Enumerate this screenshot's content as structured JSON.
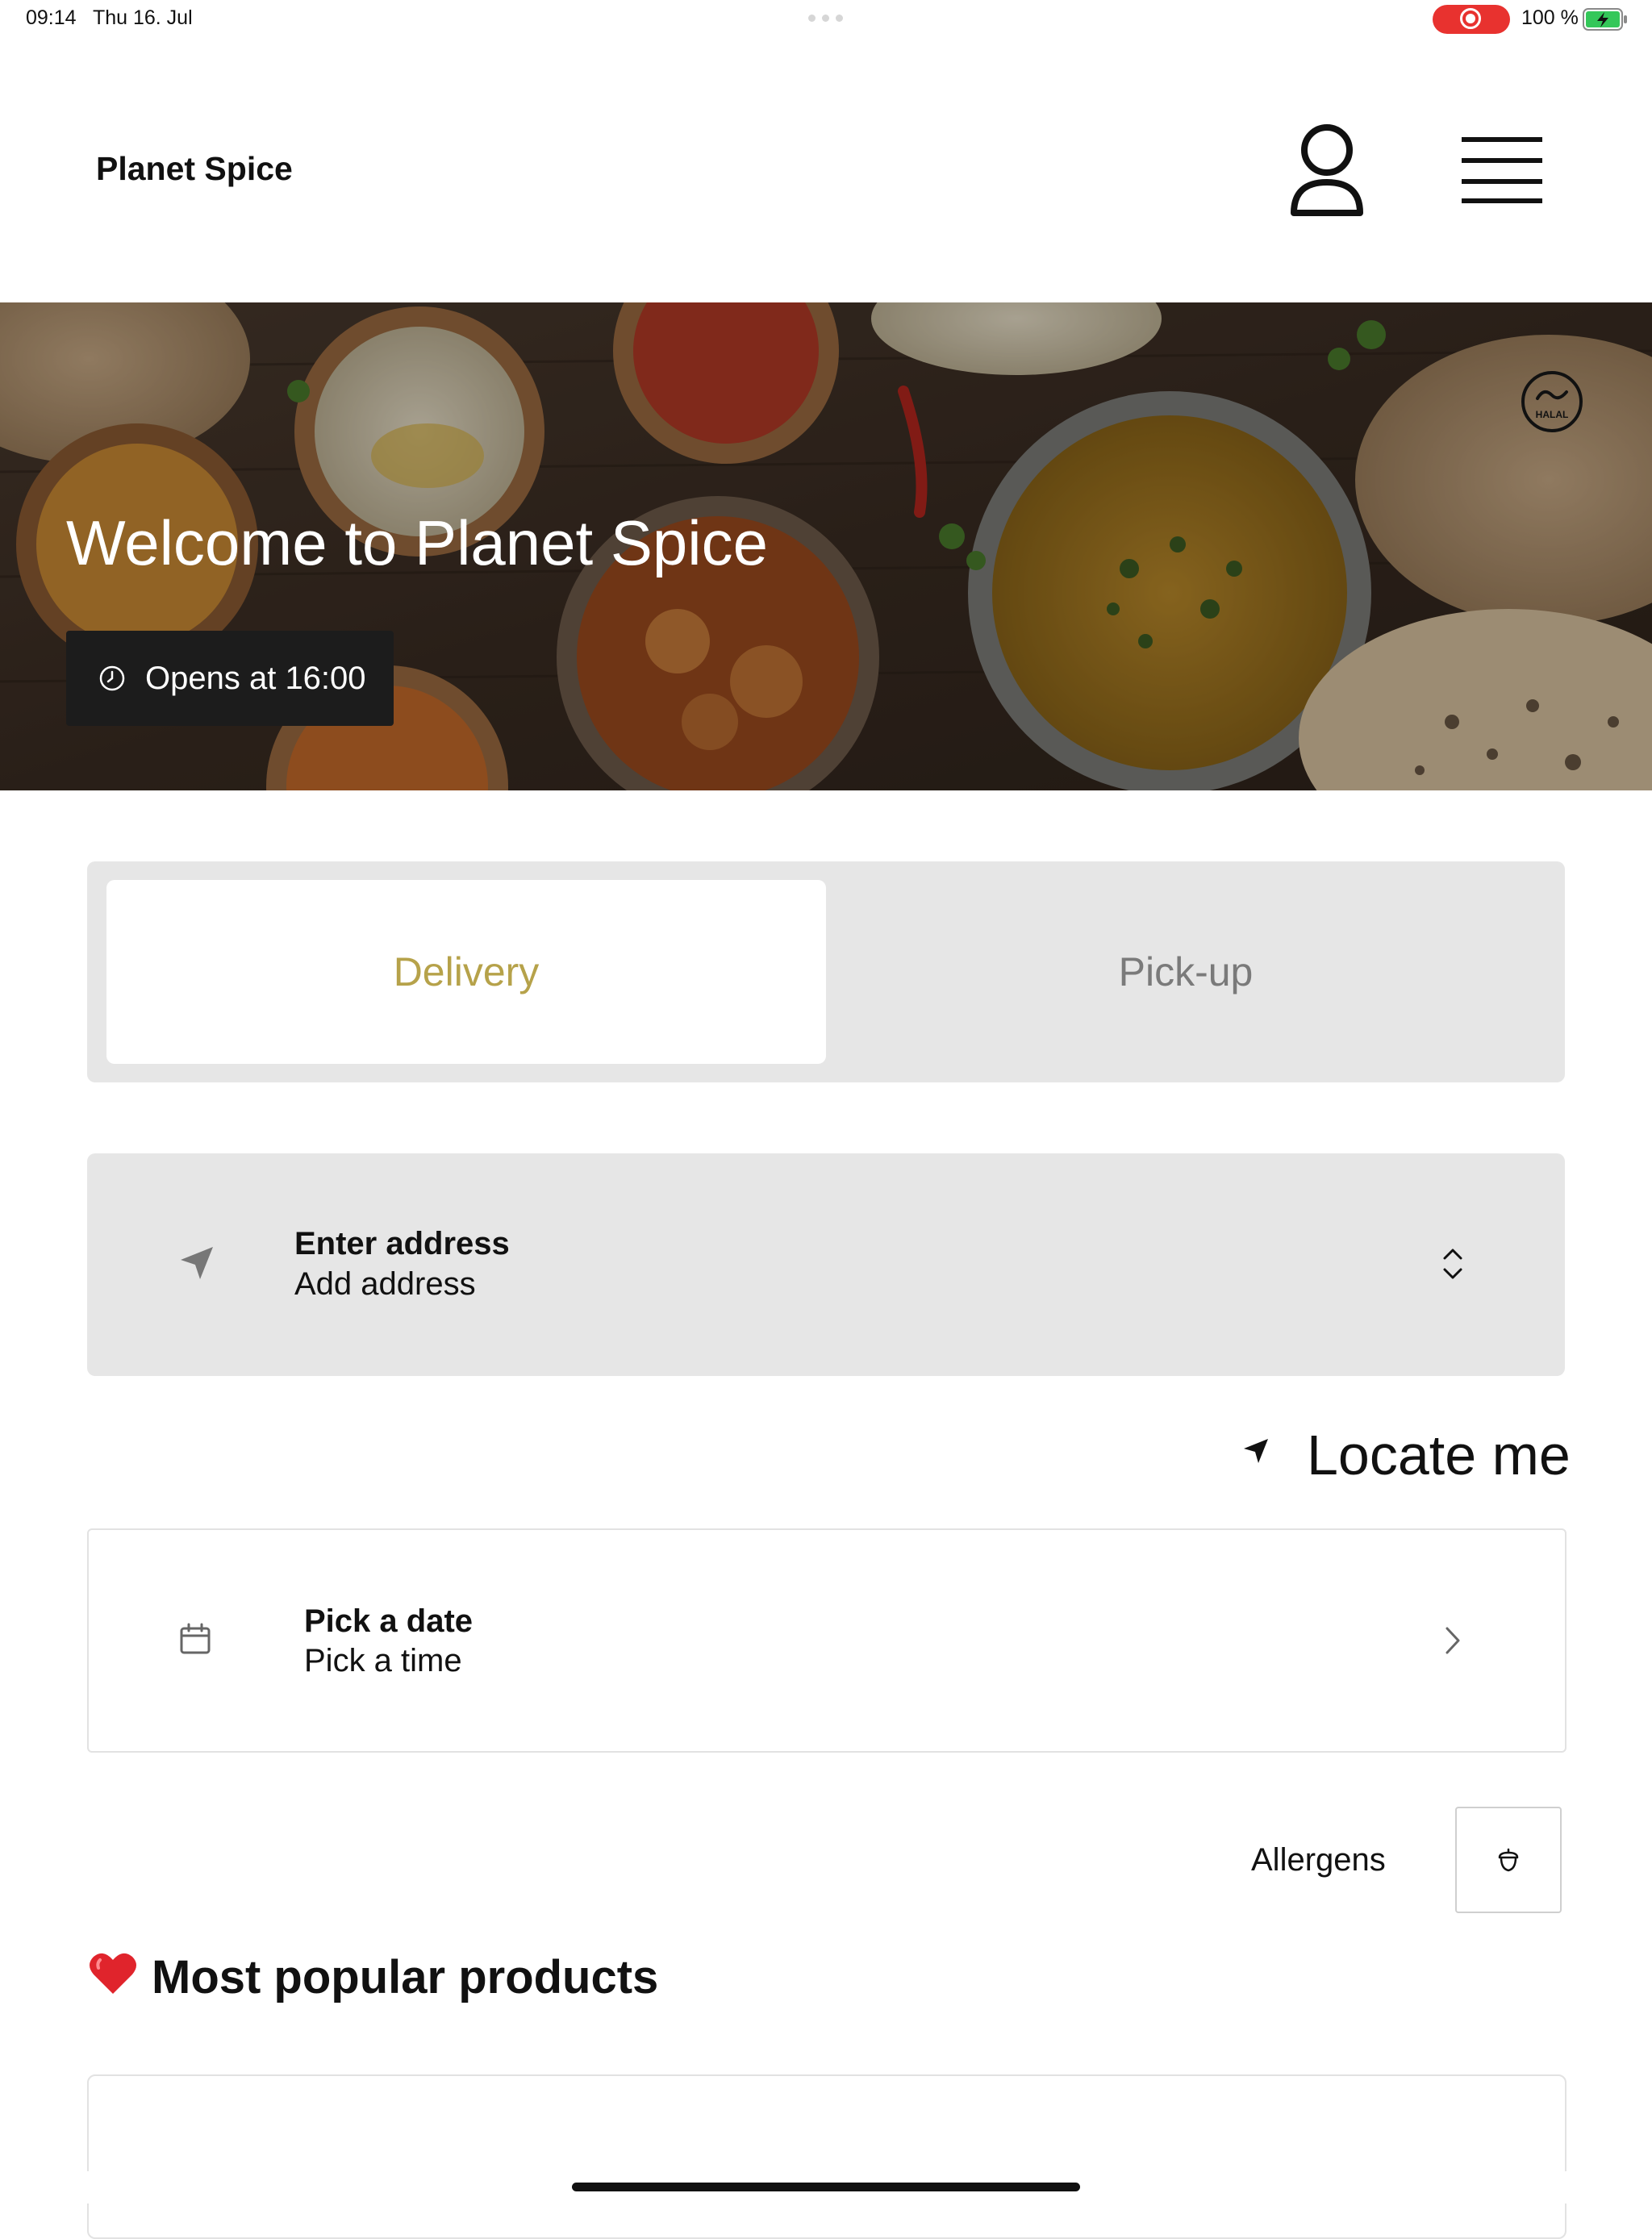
{
  "status_bar": {
    "time": "09:14",
    "date": "Thu 16. Jul",
    "battery": "100 %",
    "icons": [
      "screen-recording-icon",
      "battery-charging-icon"
    ]
  },
  "header": {
    "brand": "Planet Spice",
    "icons": [
      "user-icon",
      "menu-icon"
    ]
  },
  "hero": {
    "title": "Welcome to Planet Spice",
    "opening": "Opens at 16:00",
    "halal_badge_text": "HALAL"
  },
  "order_type": {
    "options": [
      "Delivery",
      "Pick-up"
    ],
    "selected": "Delivery",
    "accent_color": "#b6a24a"
  },
  "address": {
    "title": "Enter address",
    "subtitle": "Add address"
  },
  "locate": {
    "label": "Locate me"
  },
  "schedule": {
    "title": "Pick a date",
    "subtitle": "Pick a time"
  },
  "allergens": {
    "label": "Allergens",
    "icon": "acorn-icon"
  },
  "popular": {
    "emoji": "heart-icon",
    "title": "Most popular products"
  }
}
